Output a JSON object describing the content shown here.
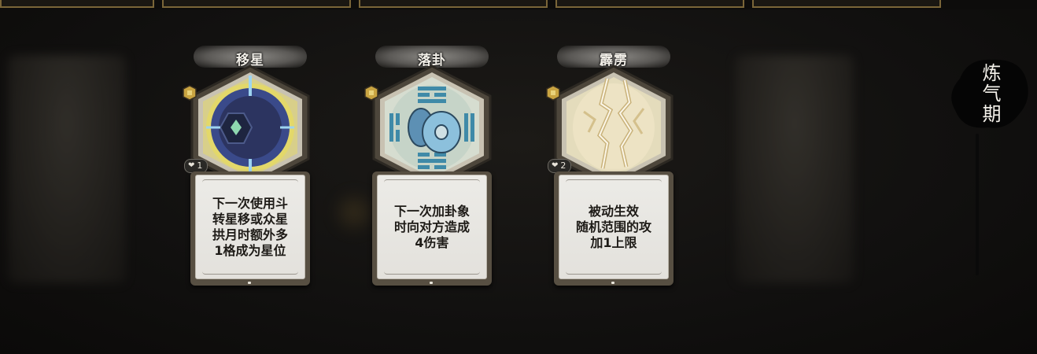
{
  "cards": [
    {
      "title": "移星",
      "description": "下一次使用斗\n转星移或众星\n拱月时额外多\n1格成为星位",
      "cost": "1",
      "art_icon": "crescent-moon-star-icon"
    },
    {
      "title": "落卦",
      "description": "下一次加卦象\n时向对方造成\n4伤害",
      "cost": null,
      "art_icon": "bagua-coin-icon"
    },
    {
      "title": "霹雳",
      "description": "被动生效\n随机范围的攻\n加1上限",
      "cost": "2",
      "art_icon": "lightning-icon"
    }
  ],
  "realm_label": "炼气期",
  "colors": {
    "frame": "#574f42",
    "paper": "#ecebe7",
    "accent_gold": "#c9a441",
    "background": "#121110"
  }
}
